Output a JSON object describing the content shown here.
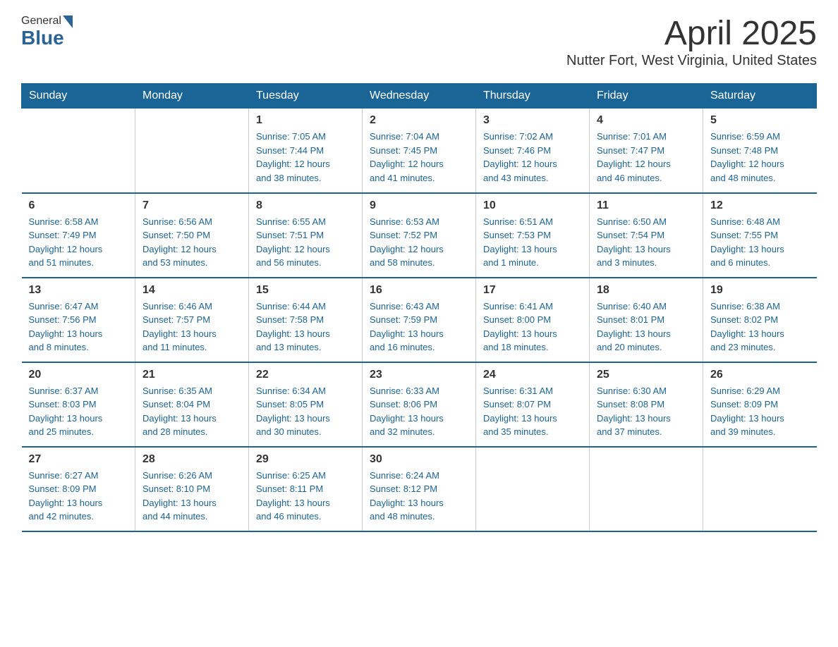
{
  "header": {
    "logo_general": "General",
    "logo_blue": "Blue",
    "month_title": "April 2025",
    "location": "Nutter Fort, West Virginia, United States"
  },
  "days_of_week": [
    "Sunday",
    "Monday",
    "Tuesday",
    "Wednesday",
    "Thursday",
    "Friday",
    "Saturday"
  ],
  "weeks": [
    {
      "days": [
        {
          "number": "",
          "info": ""
        },
        {
          "number": "",
          "info": ""
        },
        {
          "number": "1",
          "info": "Sunrise: 7:05 AM\nSunset: 7:44 PM\nDaylight: 12 hours\nand 38 minutes."
        },
        {
          "number": "2",
          "info": "Sunrise: 7:04 AM\nSunset: 7:45 PM\nDaylight: 12 hours\nand 41 minutes."
        },
        {
          "number": "3",
          "info": "Sunrise: 7:02 AM\nSunset: 7:46 PM\nDaylight: 12 hours\nand 43 minutes."
        },
        {
          "number": "4",
          "info": "Sunrise: 7:01 AM\nSunset: 7:47 PM\nDaylight: 12 hours\nand 46 minutes."
        },
        {
          "number": "5",
          "info": "Sunrise: 6:59 AM\nSunset: 7:48 PM\nDaylight: 12 hours\nand 48 minutes."
        }
      ]
    },
    {
      "days": [
        {
          "number": "6",
          "info": "Sunrise: 6:58 AM\nSunset: 7:49 PM\nDaylight: 12 hours\nand 51 minutes."
        },
        {
          "number": "7",
          "info": "Sunrise: 6:56 AM\nSunset: 7:50 PM\nDaylight: 12 hours\nand 53 minutes."
        },
        {
          "number": "8",
          "info": "Sunrise: 6:55 AM\nSunset: 7:51 PM\nDaylight: 12 hours\nand 56 minutes."
        },
        {
          "number": "9",
          "info": "Sunrise: 6:53 AM\nSunset: 7:52 PM\nDaylight: 12 hours\nand 58 minutes."
        },
        {
          "number": "10",
          "info": "Sunrise: 6:51 AM\nSunset: 7:53 PM\nDaylight: 13 hours\nand 1 minute."
        },
        {
          "number": "11",
          "info": "Sunrise: 6:50 AM\nSunset: 7:54 PM\nDaylight: 13 hours\nand 3 minutes."
        },
        {
          "number": "12",
          "info": "Sunrise: 6:48 AM\nSunset: 7:55 PM\nDaylight: 13 hours\nand 6 minutes."
        }
      ]
    },
    {
      "days": [
        {
          "number": "13",
          "info": "Sunrise: 6:47 AM\nSunset: 7:56 PM\nDaylight: 13 hours\nand 8 minutes."
        },
        {
          "number": "14",
          "info": "Sunrise: 6:46 AM\nSunset: 7:57 PM\nDaylight: 13 hours\nand 11 minutes."
        },
        {
          "number": "15",
          "info": "Sunrise: 6:44 AM\nSunset: 7:58 PM\nDaylight: 13 hours\nand 13 minutes."
        },
        {
          "number": "16",
          "info": "Sunrise: 6:43 AM\nSunset: 7:59 PM\nDaylight: 13 hours\nand 16 minutes."
        },
        {
          "number": "17",
          "info": "Sunrise: 6:41 AM\nSunset: 8:00 PM\nDaylight: 13 hours\nand 18 minutes."
        },
        {
          "number": "18",
          "info": "Sunrise: 6:40 AM\nSunset: 8:01 PM\nDaylight: 13 hours\nand 20 minutes."
        },
        {
          "number": "19",
          "info": "Sunrise: 6:38 AM\nSunset: 8:02 PM\nDaylight: 13 hours\nand 23 minutes."
        }
      ]
    },
    {
      "days": [
        {
          "number": "20",
          "info": "Sunrise: 6:37 AM\nSunset: 8:03 PM\nDaylight: 13 hours\nand 25 minutes."
        },
        {
          "number": "21",
          "info": "Sunrise: 6:35 AM\nSunset: 8:04 PM\nDaylight: 13 hours\nand 28 minutes."
        },
        {
          "number": "22",
          "info": "Sunrise: 6:34 AM\nSunset: 8:05 PM\nDaylight: 13 hours\nand 30 minutes."
        },
        {
          "number": "23",
          "info": "Sunrise: 6:33 AM\nSunset: 8:06 PM\nDaylight: 13 hours\nand 32 minutes."
        },
        {
          "number": "24",
          "info": "Sunrise: 6:31 AM\nSunset: 8:07 PM\nDaylight: 13 hours\nand 35 minutes."
        },
        {
          "number": "25",
          "info": "Sunrise: 6:30 AM\nSunset: 8:08 PM\nDaylight: 13 hours\nand 37 minutes."
        },
        {
          "number": "26",
          "info": "Sunrise: 6:29 AM\nSunset: 8:09 PM\nDaylight: 13 hours\nand 39 minutes."
        }
      ]
    },
    {
      "days": [
        {
          "number": "27",
          "info": "Sunrise: 6:27 AM\nSunset: 8:09 PM\nDaylight: 13 hours\nand 42 minutes."
        },
        {
          "number": "28",
          "info": "Sunrise: 6:26 AM\nSunset: 8:10 PM\nDaylight: 13 hours\nand 44 minutes."
        },
        {
          "number": "29",
          "info": "Sunrise: 6:25 AM\nSunset: 8:11 PM\nDaylight: 13 hours\nand 46 minutes."
        },
        {
          "number": "30",
          "info": "Sunrise: 6:24 AM\nSunset: 8:12 PM\nDaylight: 13 hours\nand 48 minutes."
        },
        {
          "number": "",
          "info": ""
        },
        {
          "number": "",
          "info": ""
        },
        {
          "number": "",
          "info": ""
        }
      ]
    }
  ]
}
